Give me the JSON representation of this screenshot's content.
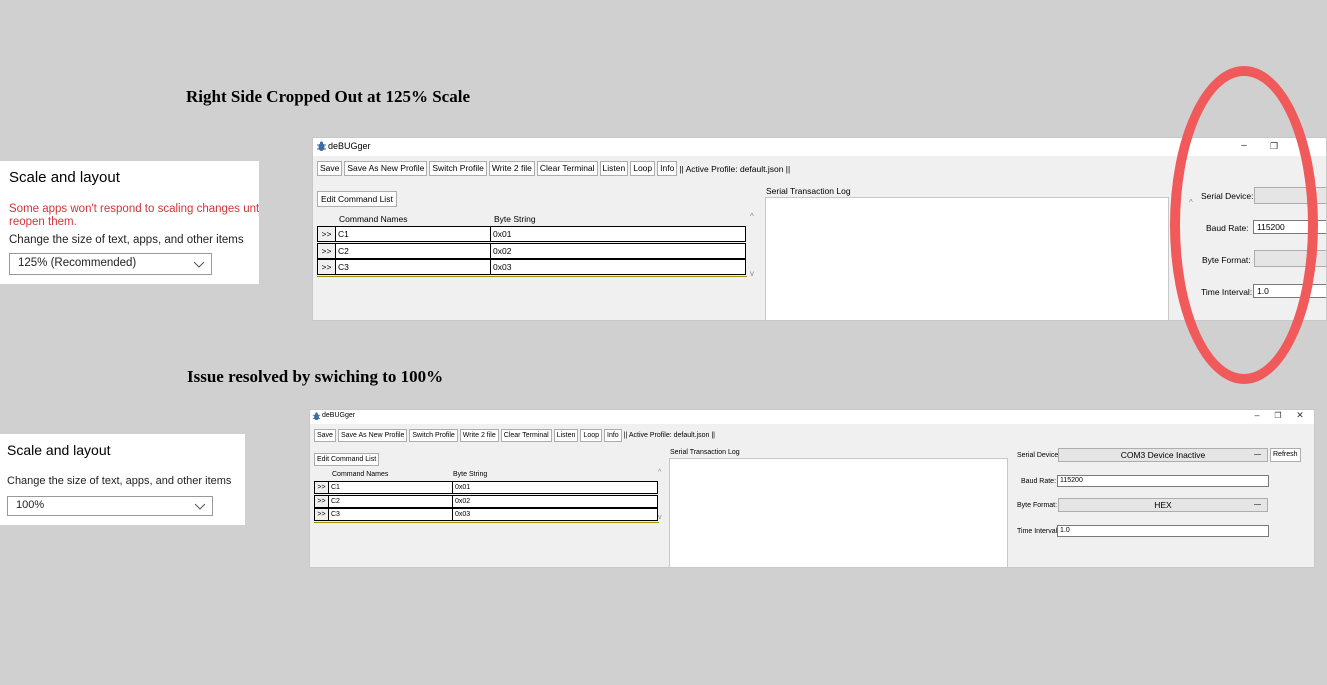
{
  "top": {
    "heading": "Right Side Cropped Out at 125% Scale",
    "settings": {
      "title": "Scale and layout",
      "warning_line1": "Some apps won't respond to scaling changes until yo",
      "warning_line2": "reopen them.",
      "label": "Change the size of text, apps, and other items",
      "dropdown_value": "125% (Recommended)"
    },
    "app": {
      "title": "deBUGger",
      "window_controls": [
        "–",
        "❐",
        "✕"
      ],
      "toolbar": [
        "Save",
        "Save As New Profile",
        "Switch Profile",
        "Write 2 file",
        "Clear Terminal",
        "Listen",
        "Loop",
        "Info"
      ],
      "active_profile": "|| Active Profile: default.json ||",
      "edit_button": "Edit Command List",
      "col_names": "Command Names",
      "col_bytes": "Byte String",
      "commands": [
        {
          "arrow": ">>",
          "name": "C1",
          "bytes": "0x01"
        },
        {
          "arrow": ">>",
          "name": "C2",
          "bytes": "0x02"
        },
        {
          "arrow": ">>",
          "name": "C3",
          "bytes": "0x03"
        }
      ],
      "log_label": "Serial Transaction Log",
      "serial_device_label": "Serial Device:",
      "baud_rate_label": "Baud Rate:",
      "baud_rate_value": "115200",
      "byte_format_label": "Byte Format:",
      "time_interval_label": "Time Interval:",
      "time_interval_value": "1.0"
    }
  },
  "bottom": {
    "heading": "Issue resolved by swiching to 100%",
    "settings": {
      "title": "Scale and layout",
      "label": "Change the size of text, apps, and other items",
      "dropdown_value": "100%"
    },
    "app": {
      "title": "deBUGger",
      "window_controls": [
        "–",
        "❐",
        "✕"
      ],
      "toolbar": [
        "Save",
        "Save As New Profile",
        "Switch Profile",
        "Write 2 file",
        "Clear Terminal",
        "Listen",
        "Loop",
        "Info"
      ],
      "active_profile": "|| Active Profile: default.json ||",
      "edit_button": "Edit Command List",
      "col_names": "Command Names",
      "col_bytes": "Byte String",
      "commands": [
        {
          "arrow": ">>",
          "name": "C1",
          "bytes": "0x01"
        },
        {
          "arrow": ">>",
          "name": "C2",
          "bytes": "0x02"
        },
        {
          "arrow": ">>",
          "name": "C3",
          "bytes": "0x03"
        }
      ],
      "log_label": "Serial Transaction Log",
      "serial_device_label": "Serial Device:",
      "serial_device_value": "COM3  Device Inactive",
      "refresh_button": "Refresh",
      "baud_rate_label": "Baud Rate:",
      "baud_rate_value": "115200",
      "byte_format_label": "Byte Format:",
      "byte_format_value": "HEX",
      "time_interval_label": "Time Interval:",
      "time_interval_value": "1.0"
    }
  },
  "colors": {
    "background": "#d0d0d0",
    "highlight_ellipse": "#f15a5a",
    "warning_text": "#d13438"
  }
}
